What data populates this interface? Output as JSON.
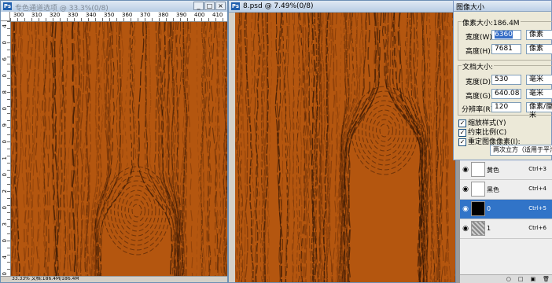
{
  "left_window": {
    "title": "专色通道选项 @ 33.3%(0/8)",
    "minimize": "_",
    "maximize": "□",
    "close": "×",
    "ruler_h": [
      "300",
      "310",
      "320",
      "330",
      "340",
      "350",
      "360",
      "370",
      "380",
      "390",
      "400",
      "410"
    ],
    "ruler_v": [
      "4",
      "0",
      "6",
      "0",
      "8",
      "0",
      "9",
      "0",
      "1",
      "0",
      "2",
      "0",
      "3",
      "0",
      "4",
      "0"
    ],
    "status": "33.33%    文档:186.4M/186.4M"
  },
  "right_window": {
    "title": "8.psd @ 7.49%(0/8)",
    "icon": "Ps"
  },
  "dialog": {
    "title": "图像大小",
    "pixel_group_title": "像素大小:186.4M",
    "width_label": "宽度(W):",
    "width_value": "6360",
    "width_unit": "像素",
    "height_label": "高度(H):",
    "height_value": "7681",
    "height_unit": "像素",
    "doc_group_title": "文档大小:",
    "doc_width_label": "宽度(D):",
    "doc_width_value": "530",
    "doc_width_unit": "毫米",
    "doc_height_label": "高度(G):",
    "doc_height_value": "640.08",
    "doc_height_unit": "毫米",
    "resolution_label": "分辨率(R):",
    "resolution_value": "120",
    "resolution_unit": "像素/厘米",
    "scale_styles": "缩放样式(Y)",
    "constrain": "约束比例(C)",
    "resample": "重定图像像素(I):",
    "resample_method": "两次立方（适用于平滑渐变）"
  },
  "layers": [
    {
      "name": "黄色",
      "shortcut": "Ctrl+3",
      "thumb": "#ffffff",
      "selected": false
    },
    {
      "name": "黑色",
      "shortcut": "Ctrl+4",
      "thumb": "#ffffff",
      "selected": false
    },
    {
      "name": "0",
      "shortcut": "Ctrl+5",
      "thumb": "#000000",
      "selected": true
    },
    {
      "name": "1",
      "shortcut": "Ctrl+6",
      "thumb": "#aaaaaa",
      "selected": false
    }
  ],
  "layer_footer_icons": [
    "○",
    "□",
    "▣",
    "🗑"
  ],
  "colors": {
    "wood_base": "#b4560f",
    "wood_dark": "#3a1a05",
    "selection": "#316ac5"
  }
}
